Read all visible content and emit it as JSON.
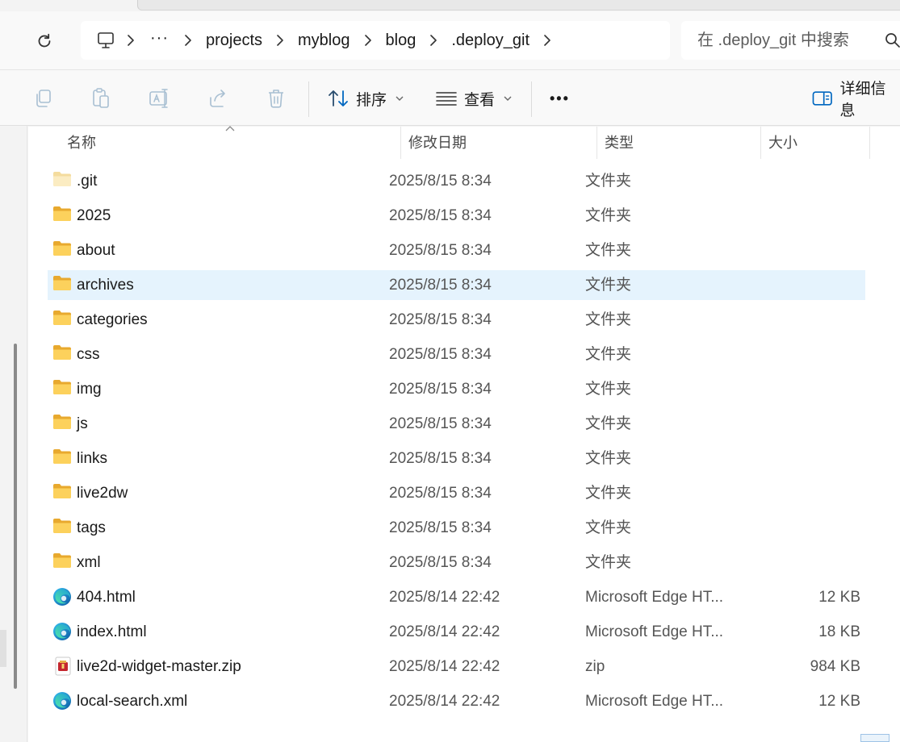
{
  "address_bar": {
    "overflow_label": "···",
    "breadcrumbs": [
      "projects",
      "myblog",
      "blog",
      ".deploy_git"
    ]
  },
  "search": {
    "placeholder": "在 .deploy_git 中搜索"
  },
  "command_bar": {
    "sort_label": "排序",
    "view_label": "查看",
    "more_label": "•••",
    "details_label": "详细信息"
  },
  "columns": {
    "name": "名称",
    "date": "修改日期",
    "type": "类型",
    "size": "大小"
  },
  "files": [
    {
      "name": ".git",
      "date": "2025/8/15 8:34",
      "type": "文件夹",
      "size": "",
      "icon": "folder-light-icon"
    },
    {
      "name": "2025",
      "date": "2025/8/15 8:34",
      "type": "文件夹",
      "size": "",
      "icon": "folder-icon"
    },
    {
      "name": "about",
      "date": "2025/8/15 8:34",
      "type": "文件夹",
      "size": "",
      "icon": "folder-icon"
    },
    {
      "name": "archives",
      "date": "2025/8/15 8:34",
      "type": "文件夹",
      "size": "",
      "icon": "folder-icon",
      "selected": true
    },
    {
      "name": "categories",
      "date": "2025/8/15 8:34",
      "type": "文件夹",
      "size": "",
      "icon": "folder-icon"
    },
    {
      "name": "css",
      "date": "2025/8/15 8:34",
      "type": "文件夹",
      "size": "",
      "icon": "folder-icon"
    },
    {
      "name": "img",
      "date": "2025/8/15 8:34",
      "type": "文件夹",
      "size": "",
      "icon": "folder-icon"
    },
    {
      "name": "js",
      "date": "2025/8/15 8:34",
      "type": "文件夹",
      "size": "",
      "icon": "folder-icon"
    },
    {
      "name": "links",
      "date": "2025/8/15 8:34",
      "type": "文件夹",
      "size": "",
      "icon": "folder-icon"
    },
    {
      "name": "live2dw",
      "date": "2025/8/15 8:34",
      "type": "文件夹",
      "size": "",
      "icon": "folder-icon"
    },
    {
      "name": "tags",
      "date": "2025/8/15 8:34",
      "type": "文件夹",
      "size": "",
      "icon": "folder-icon"
    },
    {
      "name": "xml",
      "date": "2025/8/15 8:34",
      "type": "文件夹",
      "size": "",
      "icon": "folder-icon"
    },
    {
      "name": "404.html",
      "date": "2025/8/14 22:42",
      "type": "Microsoft Edge HT...",
      "size": "12 KB",
      "icon": "edge-icon"
    },
    {
      "name": "index.html",
      "date": "2025/8/14 22:42",
      "type": "Microsoft Edge HT...",
      "size": "18 KB",
      "icon": "edge-icon"
    },
    {
      "name": "live2d-widget-master.zip",
      "date": "2025/8/14 22:42",
      "type": "zip",
      "size": "984 KB",
      "icon": "zip-archive-icon"
    },
    {
      "name": "local-search.xml",
      "date": "2025/8/14 22:42",
      "type": "Microsoft Edge HT...",
      "size": "12 KB",
      "icon": "edge-icon"
    }
  ],
  "colors": {
    "selection": "#e5f3fd",
    "folder": "#f8c94b",
    "accent": "#0067c0"
  }
}
